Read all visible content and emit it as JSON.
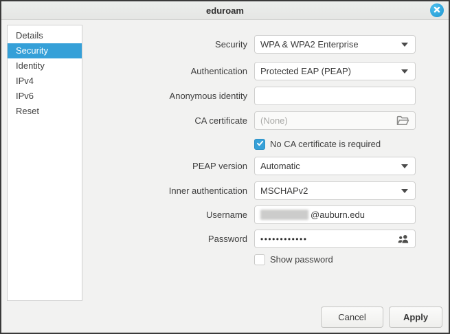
{
  "window": {
    "title": "eduroam"
  },
  "sidebar": {
    "selected": "Security",
    "items": [
      {
        "label": "Details",
        "selected": false
      },
      {
        "label": "Security",
        "selected": true
      },
      {
        "label": "Identity",
        "selected": false
      },
      {
        "label": "IPv4",
        "selected": false
      },
      {
        "label": "IPv6",
        "selected": false
      },
      {
        "label": "Reset",
        "selected": false
      }
    ]
  },
  "form": {
    "security": {
      "label": "Security",
      "value": "WPA & WPA2 Enterprise",
      "type": "dropdown"
    },
    "authentication": {
      "label": "Authentication",
      "value": "Protected EAP (PEAP)",
      "type": "dropdown"
    },
    "anonymous_identity": {
      "label": "Anonymous identity",
      "value": "",
      "type": "text"
    },
    "ca_certificate": {
      "label": "CA certificate",
      "value": "(None)",
      "type": "file-picker",
      "icon": "folder-open-icon"
    },
    "no_ca_required": {
      "label": "No CA certificate is required",
      "checked": true
    },
    "peap_version": {
      "label": "PEAP version",
      "value": "Automatic",
      "type": "dropdown"
    },
    "inner_auth": {
      "label": "Inner authentication",
      "value": "MSCHAPv2",
      "type": "dropdown"
    },
    "username": {
      "label": "Username",
      "redacted": true,
      "visible_text": "@auburn.edu"
    },
    "password": {
      "label": "Password",
      "value": "••••••••••••",
      "icon": "users-icon"
    },
    "show_password": {
      "label": "Show password",
      "checked": false
    }
  },
  "footer": {
    "cancel_label": "Cancel",
    "apply_label": "Apply"
  },
  "colors": {
    "accent_blue": "#35a0d8",
    "window_bg": "#f2f2f1",
    "titlebar_bg": "#e8e8e7"
  }
}
